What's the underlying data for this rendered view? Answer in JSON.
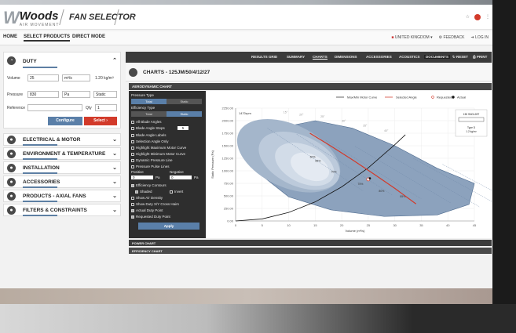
{
  "header": {
    "logo_name": "Woods",
    "logo_sub": "AIR MOVEMENT",
    "app_title": "FAN SELECTOR"
  },
  "nav": {
    "home": "HOME",
    "select_products": "SELECT PRODUCTS",
    "direct_mode": "DIRECT MODE",
    "region": "UNITED KINGDOM",
    "feedback": "FEEDBACK",
    "login": "LOG IN"
  },
  "duty": {
    "title": "DUTY",
    "volume_label": "Volume",
    "volume_value": "25",
    "volume_unit": "m³/s",
    "density": "1.20 kg/m³",
    "pressure_label": "Pressure",
    "pressure_value": "830",
    "pressure_unit": "Pa",
    "pressure_type": "Static",
    "reference_label": "Reference",
    "qty_label": "Qty",
    "qty_value": "1",
    "configure_label": "Configure",
    "select_label": "Select"
  },
  "sections": [
    {
      "title": "ELECTRICAL & MOTOR",
      "icon": "plug-icon"
    },
    {
      "title": "ENVIRONMENT & TEMPERATURE",
      "icon": "leaf-icon"
    },
    {
      "title": "INSTALLATION",
      "icon": "wrench-icon"
    },
    {
      "title": "ACCESSORIES",
      "icon": "gear-icon"
    },
    {
      "title": "PRODUCTS - AXIAL FANS",
      "icon": "fan-icon"
    },
    {
      "title": "FILTERS & CONSTRAINTS",
      "icon": "link-icon"
    }
  ],
  "tabs": {
    "results_grid": "RESULTS GRID",
    "summary": "SUMMARY",
    "charts": "CHARTS",
    "dimensions": "DIMENSIONS",
    "accessories": "ACCESSORIES",
    "acoustics": "ACOUSTICS",
    "documents": "DOCUMENTS",
    "reset": "RESET",
    "print": "PRINT"
  },
  "charts": {
    "title": "CHARTS - 125JM/50/4/12/27",
    "aero_title": "AERODYNAMIC CHART",
    "power_title": "POWER CHART",
    "efficiency_title": "EFFICIENCY CHART"
  },
  "options": {
    "pressure_type": "Pressure Type",
    "total": "Total",
    "static": "Static",
    "efficiency_type": "Efficiency Type",
    "all_blade": "All Blade Angles",
    "blade_steps": "Blade Angle Steps",
    "blade_steps_value": "5",
    "blade_labels": "Blade Angle Labels",
    "selection_only": "Selection Angle Only",
    "highlight_max": "Highlight Maximum Motor Curve",
    "highlight_min": "Highlight Minimum Motor Curve",
    "dynamic_line": "Dynamic Pressure Line",
    "pulse_lines": "Pressure Pulse Lines",
    "positive": "Positive",
    "negative": "Negative",
    "pos_value": "0",
    "neg_value": "0",
    "pa": "Pa",
    "eff_contours": "Efficiency Contours",
    "shaded": "Shaded",
    "invert": "Invert",
    "air_density": "Show Air Density",
    "show_duty": "Show Duty X/Y Cross Hairs",
    "actual_duty": "Actual Duty Point",
    "requested_duty": "Requested Duty Point",
    "apply": "Apply"
  },
  "chart_data": {
    "type": "line",
    "legend": [
      "Max/Min Motor Curve",
      "Selected Angle",
      "Requested",
      "Actual"
    ],
    "xlabel": "Volume (m³/s)",
    "ylabel": "Static Pressure (Pa)",
    "xlim": [
      0,
      45
    ],
    "ylim": [
      0,
      2250
    ],
    "x_ticks": [
      "0",
      "5",
      "10",
      "15",
      "20",
      "25",
      "30",
      "35",
      "40",
      "45"
    ],
    "y_ticks": [
      "0.00",
      "250.00",
      "500.00",
      "750.00",
      "1000.00",
      "1250.00",
      "1500.00",
      "1750.00",
      "2000.00",
      "2250.00"
    ],
    "rpm_label": "1470rpm",
    "contour_labels": [
      "60%",
      "65%",
      "70%",
      "75%",
      "80%",
      "85%"
    ],
    "angle_labels": [
      "15°",
      "20°",
      "25°",
      "30°",
      "35°",
      "40°"
    ],
    "inset": {
      "title": "150 SNGL28T",
      "type": "Type D",
      "density": "1.2 kg/m³"
    },
    "selected_curve": {
      "x": [
        14,
        18,
        22,
        26,
        30,
        34
      ],
      "y": [
        1750,
        1490,
        1220,
        940,
        650,
        340
      ]
    },
    "system_curve": {
      "x": [
        0,
        5,
        10,
        15,
        20,
        25,
        30,
        32
      ],
      "y": [
        0,
        40,
        170,
        380,
        680,
        1060,
        1520,
        1720
      ]
    },
    "requested": {
      "x": 25,
      "y": 830
    },
    "actual": {
      "x": 25.3,
      "y": 850
    }
  },
  "colors": {
    "accent_red": "#d23a2a",
    "dark": "#3b3b3b",
    "blue": "#5a7fa8"
  }
}
